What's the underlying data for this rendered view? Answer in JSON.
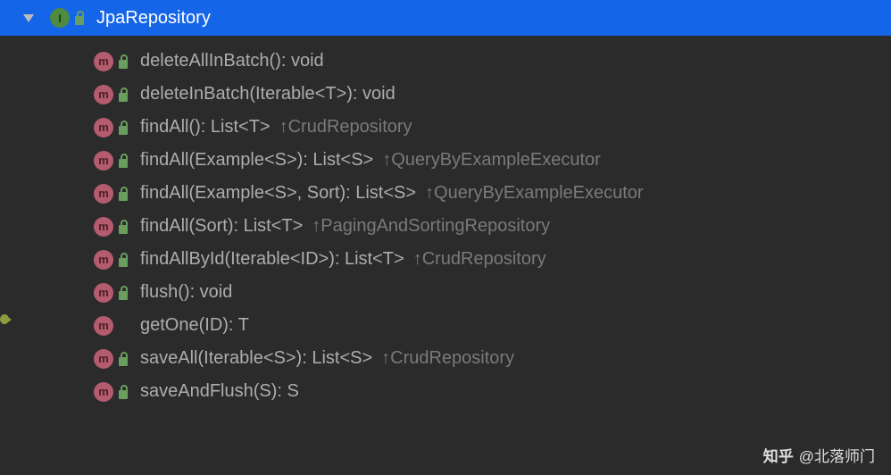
{
  "root": {
    "label": "JpaRepository",
    "icon": "I"
  },
  "methods": [
    {
      "signature": "deleteAllInBatch(): void",
      "override": null,
      "hasLock": true
    },
    {
      "signature": "deleteInBatch(Iterable<T>): void",
      "override": null,
      "hasLock": true
    },
    {
      "signature": "findAll(): List<T>",
      "override": "CrudRepository",
      "hasLock": true
    },
    {
      "signature": "findAll(Example<S>): List<S>",
      "override": "QueryByExampleExecutor",
      "hasLock": true
    },
    {
      "signature": "findAll(Example<S>, Sort): List<S>",
      "override": "QueryByExampleExecutor",
      "hasLock": true
    },
    {
      "signature": "findAll(Sort): List<T>",
      "override": "PagingAndSortingRepository",
      "hasLock": true
    },
    {
      "signature": "findAllById(Iterable<ID>): List<T>",
      "override": "CrudRepository",
      "hasLock": true
    },
    {
      "signature": "flush(): void",
      "override": null,
      "hasLock": true
    },
    {
      "signature": "getOne(ID): T",
      "override": null,
      "hasLock": false
    },
    {
      "signature": "saveAll(Iterable<S>): List<S>",
      "override": "CrudRepository",
      "hasLock": true
    },
    {
      "signature": "saveAndFlush(S): S",
      "override": null,
      "hasLock": true
    }
  ],
  "icon_letter": "m",
  "watermark": {
    "logo": "知乎",
    "text": "@北落师门"
  }
}
